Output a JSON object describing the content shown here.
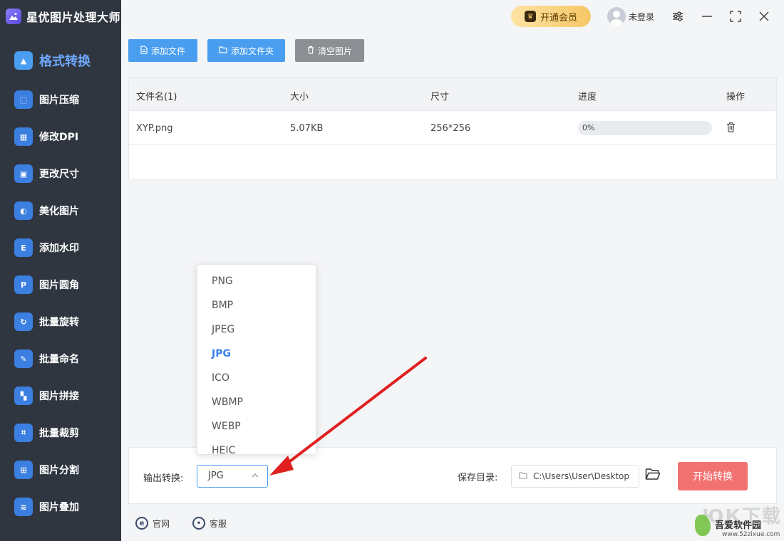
{
  "app": {
    "title": "星优图片处理大师"
  },
  "sidebar": {
    "items": [
      {
        "label": "格式转换",
        "icon": "image-convert-icon",
        "color": "#4a9ef0"
      },
      {
        "label": "图片压缩",
        "icon": "compress-icon",
        "color": "#3b7fe0"
      },
      {
        "label": "修改DPI",
        "icon": "dpi-icon",
        "color": "#3b7fe0"
      },
      {
        "label": "更改尺寸",
        "icon": "resize-icon",
        "color": "#3b7fe0"
      },
      {
        "label": "美化图片",
        "icon": "beautify-icon",
        "color": "#3b7fe0"
      },
      {
        "label": "添加水印",
        "icon": "watermark-icon",
        "color": "#3b7fe0"
      },
      {
        "label": "图片圆角",
        "icon": "round-corner-icon",
        "color": "#3b7fe0"
      },
      {
        "label": "批量旋转",
        "icon": "rotate-icon",
        "color": "#3b7fe0"
      },
      {
        "label": "批量命名",
        "icon": "rename-icon",
        "color": "#3b7fe0"
      },
      {
        "label": "图片拼接",
        "icon": "stitch-icon",
        "color": "#3b7fe0"
      },
      {
        "label": "批量裁剪",
        "icon": "crop-icon",
        "color": "#3b7fe0"
      },
      {
        "label": "图片分割",
        "icon": "split-icon",
        "color": "#3b7fe0"
      },
      {
        "label": "图片叠加",
        "icon": "layers-icon",
        "color": "#3b7fe0"
      }
    ]
  },
  "topbar": {
    "vip_label": "开通会员",
    "user_label": "未登录"
  },
  "toolbar": {
    "add_file": "添加文件",
    "add_folder": "添加文件夹",
    "clear_images": "清空图片"
  },
  "table": {
    "columns": [
      "文件名(1)",
      "大小",
      "尺寸",
      "进度",
      "操作"
    ],
    "rows": [
      {
        "name": "XYP.png",
        "size": "5.07KB",
        "dimensions": "256*256",
        "progress_text": "0%",
        "progress": 0
      }
    ]
  },
  "dropdown": {
    "options": [
      "PNG",
      "BMP",
      "JPEG",
      "JPG",
      "ICO",
      "WBMP",
      "WEBP",
      "HEIC"
    ],
    "selected": "JPG"
  },
  "bottom": {
    "output_label": "输出转换:",
    "output_value": "JPG",
    "save_label": "保存目录:",
    "save_path": "C:\\Users\\User\\Desktop",
    "start_label": "开始转换"
  },
  "footer": {
    "website": "官网",
    "support": "客服"
  },
  "watermark": {
    "big": "ЮК下载",
    "mid": "吾爱软件园",
    "small": "www.52zixue.com"
  },
  "colors": {
    "accent": "#4a9ef0",
    "start": "#f27272",
    "sidebar_bg": "#2f3640",
    "annotation_arrow": "#e02020"
  }
}
